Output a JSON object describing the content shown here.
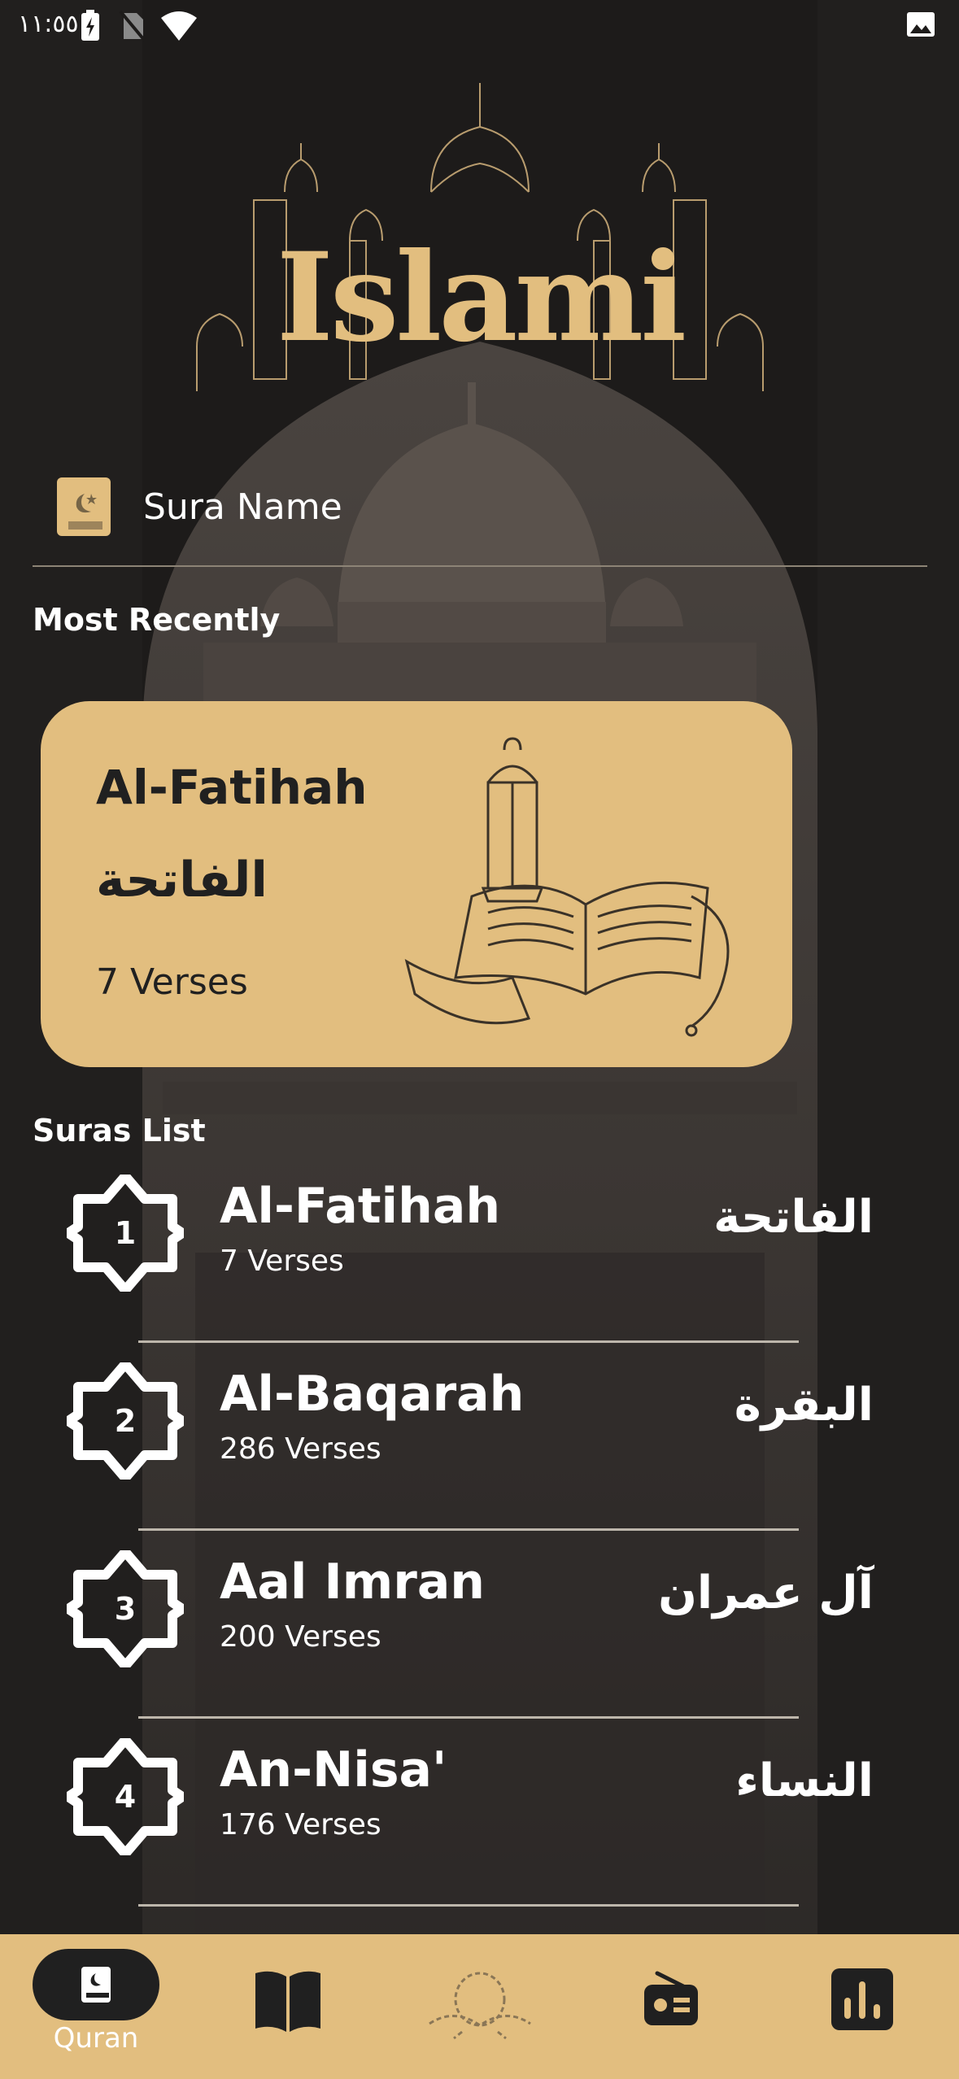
{
  "status_bar": {
    "time": "١١:٥٥"
  },
  "app": {
    "logo_text": "Islami"
  },
  "search": {
    "placeholder": "Sura Name"
  },
  "sections": {
    "recent_title": "Most Recently",
    "list_title": "Suras List"
  },
  "recent": {
    "name_en": "Al-Fatihah",
    "name_ar": "الفاتحة",
    "verses": "7 Verses"
  },
  "suras": [
    {
      "number": "1",
      "name_en": "Al-Fatihah",
      "verses": "7 Verses",
      "name_ar": "الفاتحة"
    },
    {
      "number": "2",
      "name_en": "Al-Baqarah",
      "verses": "286 Verses",
      "name_ar": "البقرة"
    },
    {
      "number": "3",
      "name_en": "Aal Imran",
      "verses": "200 Verses",
      "name_ar": "آل عمران"
    },
    {
      "number": "4",
      "name_en": "An-Nisa'",
      "verses": "176 Verses",
      "name_ar": "النساء"
    }
  ],
  "nav": {
    "items": [
      {
        "icon": "quran-icon",
        "label": "Quran",
        "active": true
      },
      {
        "icon": "book-icon",
        "label": "",
        "active": false
      },
      {
        "icon": "sebha-icon",
        "label": "",
        "active": false
      },
      {
        "icon": "radio-icon",
        "label": "",
        "active": false
      },
      {
        "icon": "stats-icon",
        "label": "",
        "active": false
      }
    ]
  },
  "colors": {
    "accent": "#e2be7f",
    "background": "#1d1b1a",
    "text_dark": "#202020",
    "text_light": "#ffffff"
  }
}
